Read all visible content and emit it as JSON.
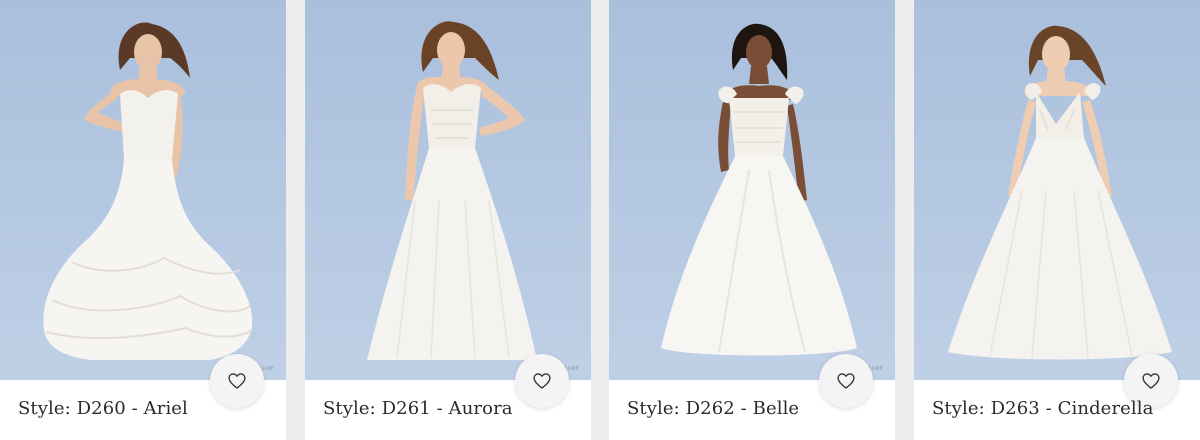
{
  "products": [
    {
      "style_label": "Style: D260 - Ariel",
      "hair": "#5a3a26",
      "skin": "#e8c3a8",
      "dress_shape": "mermaid",
      "watermark": "ALLURE"
    },
    {
      "style_label": "Style: D261 - Aurora",
      "hair": "#6a4226",
      "skin": "#ecc7ac",
      "dress_shape": "ballgown-tulle",
      "watermark": "ALLURE"
    },
    {
      "style_label": "Style: D262 - Belle",
      "hair": "#1e1410",
      "skin": "#7a4e36",
      "dress_shape": "ballgown-satin",
      "watermark": "ALLURE"
    },
    {
      "style_label": "Style: D263 - Cinderella",
      "hair": "#6a4428",
      "skin": "#efcdb3",
      "dress_shape": "ballgown-tulle",
      "watermark": ""
    }
  ],
  "favorite_icon": "heart-icon",
  "colors": {
    "background": "#ededed",
    "card": "#ffffff",
    "photo_backdrop": "#b3c7e1",
    "dress": "#f6f4f0",
    "caption_text": "#2b2b2b"
  }
}
